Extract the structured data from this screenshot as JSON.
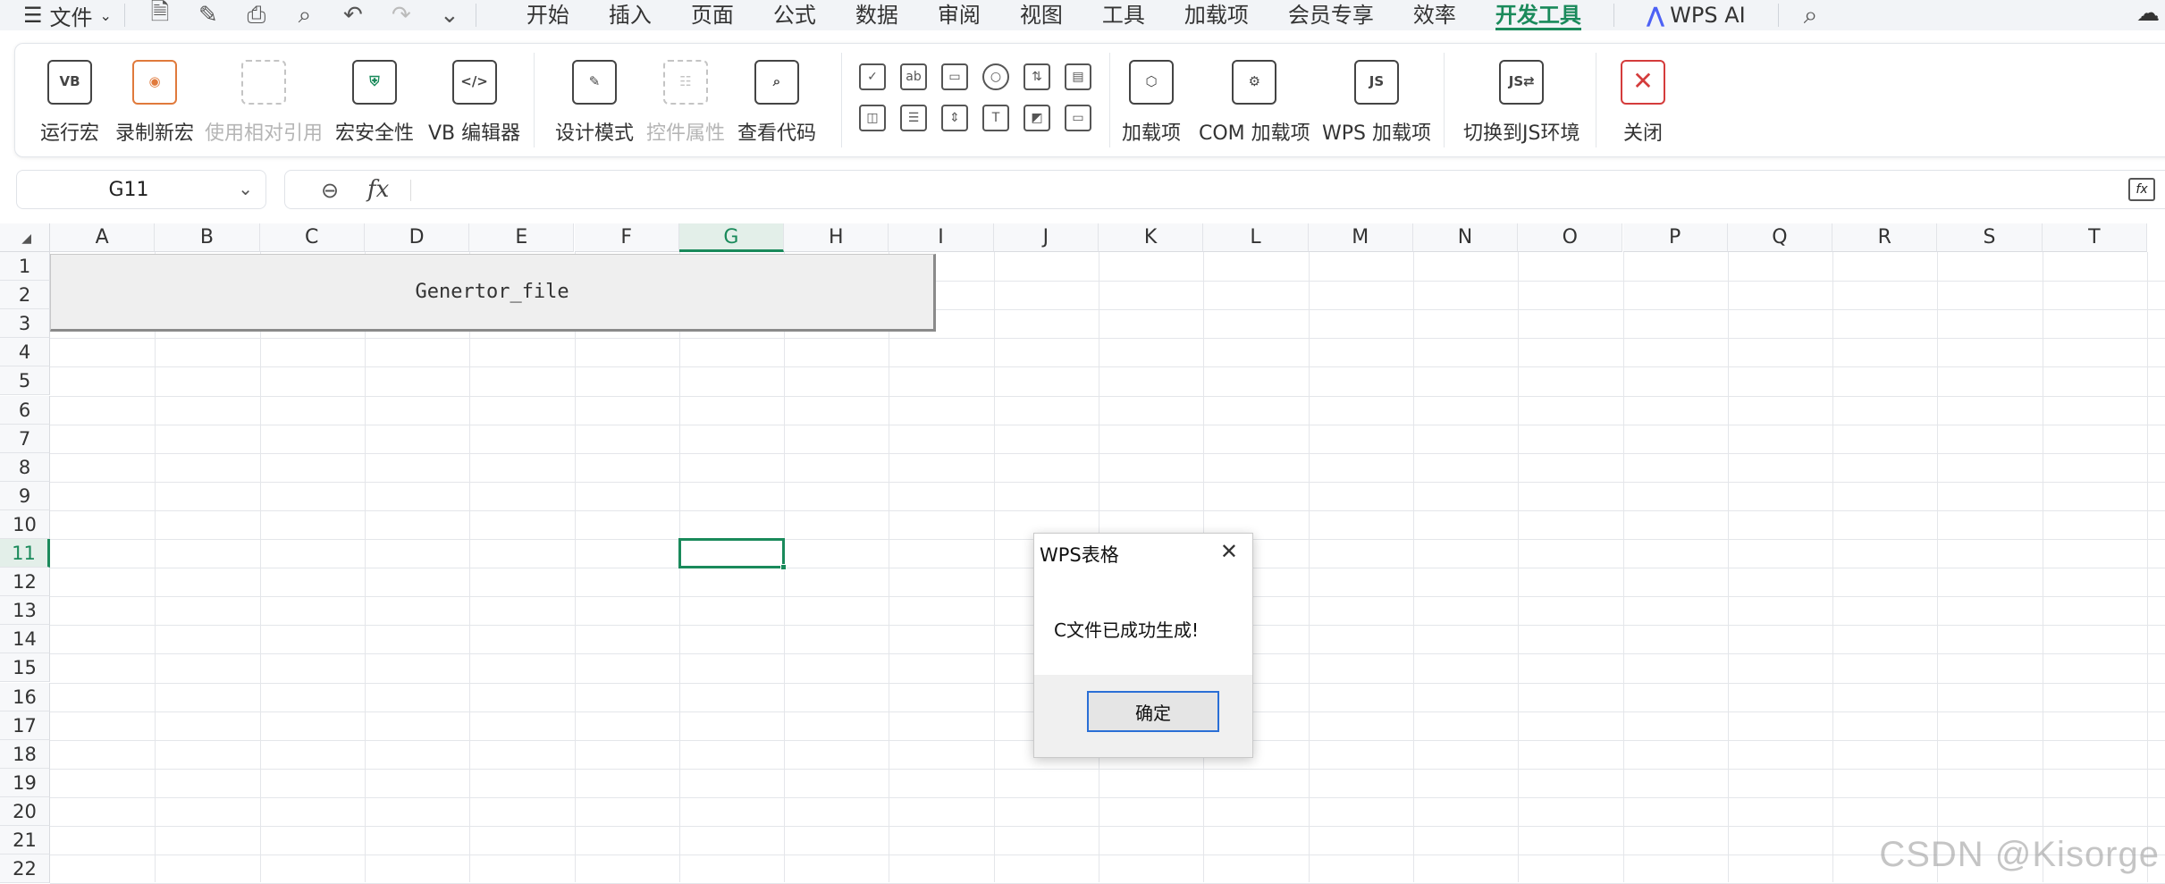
{
  "menubar": {
    "file_label": "文件",
    "tabs": [
      {
        "label": "开始"
      },
      {
        "label": "插入"
      },
      {
        "label": "页面"
      },
      {
        "label": "公式"
      },
      {
        "label": "数据"
      },
      {
        "label": "审阅"
      },
      {
        "label": "视图"
      },
      {
        "label": "工具"
      },
      {
        "label": "加载项"
      },
      {
        "label": "会员专享"
      },
      {
        "label": "效率"
      },
      {
        "label": "开发工具"
      }
    ],
    "ai_label": "WPS AI"
  },
  "ribbon": {
    "run_macro": "运行宏",
    "record_macro": "录制新宏",
    "relative_ref": "使用相对引用",
    "macro_security": "宏安全性",
    "vb_editor": "VB 编辑器",
    "design_mode": "设计模式",
    "control_props": "控件属性",
    "view_code": "查看代码",
    "addins": "加载项",
    "com_addins": "COM 加载项",
    "wps_addins": "WPS 加载项",
    "switch_js": "切换到JS环境",
    "close": "关闭"
  },
  "formula_bar": {
    "name_box": "G11",
    "formula": ""
  },
  "grid": {
    "columns": [
      "A",
      "B",
      "C",
      "D",
      "E",
      "F",
      "G",
      "H",
      "I",
      "J",
      "K",
      "L",
      "M",
      "N",
      "O",
      "P",
      "Q",
      "R",
      "S",
      "T"
    ],
    "rows": [
      "1",
      "2",
      "3",
      "4",
      "5",
      "6",
      "7",
      "8",
      "9",
      "10",
      "11",
      "12",
      "13",
      "14",
      "15",
      "16",
      "17",
      "18",
      "19",
      "20",
      "21",
      "22"
    ],
    "selected_column": "G",
    "selected_row": "11",
    "button_label": "Genertor_file"
  },
  "dialog": {
    "title": "WPS表格",
    "message": "C文件已成功生成!",
    "ok_label": "确定"
  },
  "watermark": "CSDN @Kisorge"
}
